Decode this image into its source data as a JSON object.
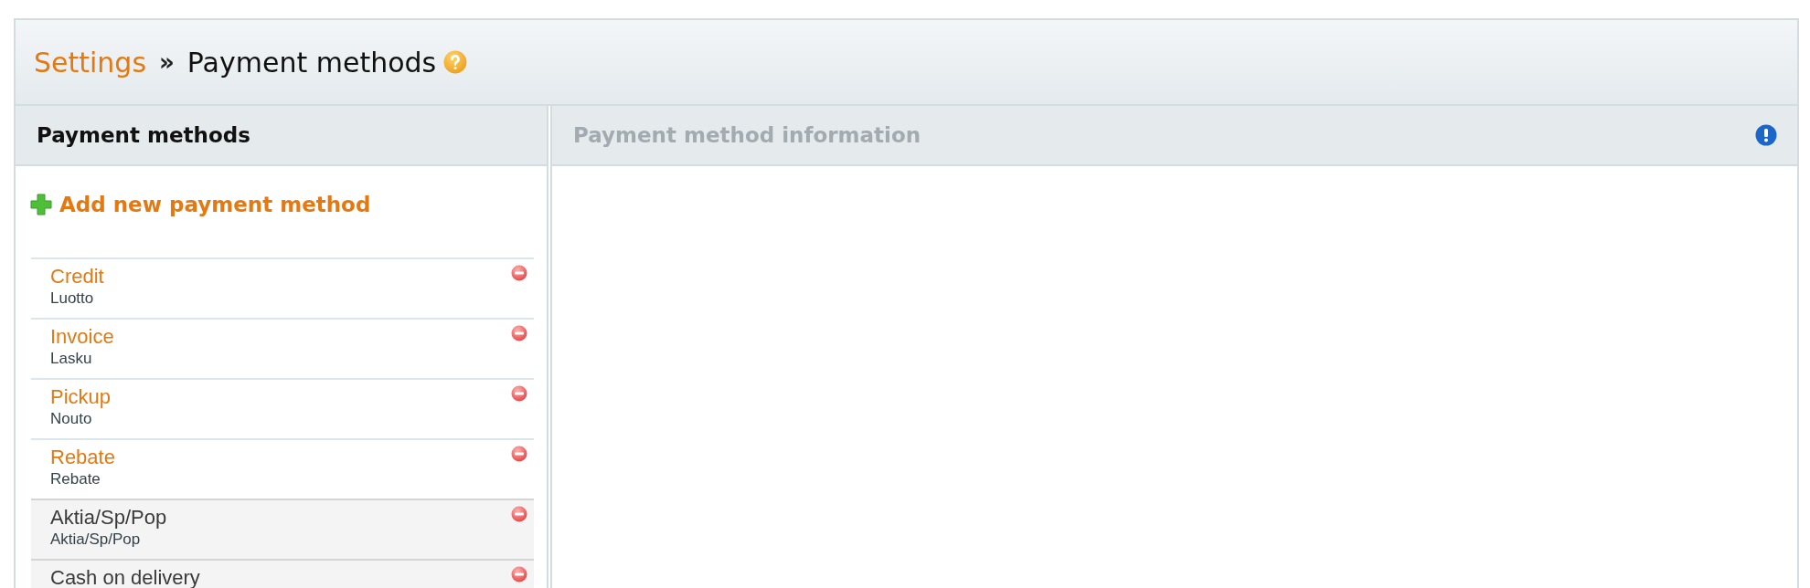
{
  "breadcrumb": [
    {
      "label": "Settings",
      "kind": "link"
    },
    {
      "label": "Payment methods",
      "kind": "current"
    }
  ],
  "separator": "»",
  "left_panel": {
    "title": "Payment methods",
    "add_link": "Add new payment method",
    "items": [
      {
        "name": "Credit",
        "subtitle": "Luotto",
        "active": true
      },
      {
        "name": "Invoice",
        "subtitle": "Lasku",
        "active": true
      },
      {
        "name": "Pickup",
        "subtitle": "Nouto",
        "active": true
      },
      {
        "name": "Rebate",
        "subtitle": "Rebate",
        "active": true
      },
      {
        "name": "Aktia/Sp/Pop",
        "subtitle": "Aktia/Sp/Pop",
        "active": false
      },
      {
        "name": "Cash on delivery",
        "active": false
      }
    ]
  },
  "right_panel": {
    "title": "Payment method information"
  }
}
